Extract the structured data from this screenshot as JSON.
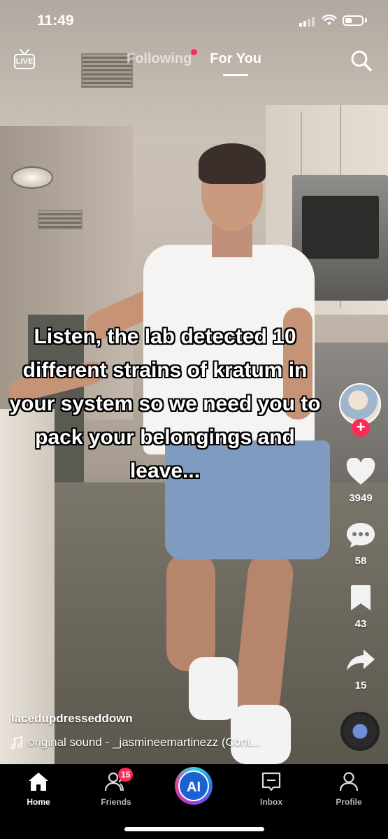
{
  "status_bar": {
    "time": "11:49"
  },
  "top_nav": {
    "live_label": "LIVE",
    "tabs": [
      {
        "label": "Following",
        "has_dot": true
      },
      {
        "label": "For You",
        "active": true
      }
    ]
  },
  "video": {
    "caption": "Listen, the lab detected 10 different strains of kratum in your system so we need you to pack your belongings and leave...",
    "username": "lacedupdresseddown",
    "sound": "original sound - _jasmineemartinezz (Cont..."
  },
  "actions": {
    "likes": "3949",
    "comments": "58",
    "saves": "43",
    "shares": "15"
  },
  "bottom_nav": {
    "items": [
      {
        "label": "Home"
      },
      {
        "label": "Friends",
        "badge": "15"
      },
      {
        "label": "AI"
      },
      {
        "label": "Inbox"
      },
      {
        "label": "Profile"
      }
    ]
  },
  "colors": {
    "accent": "#fe2c55",
    "nav_bg": "#000000"
  }
}
